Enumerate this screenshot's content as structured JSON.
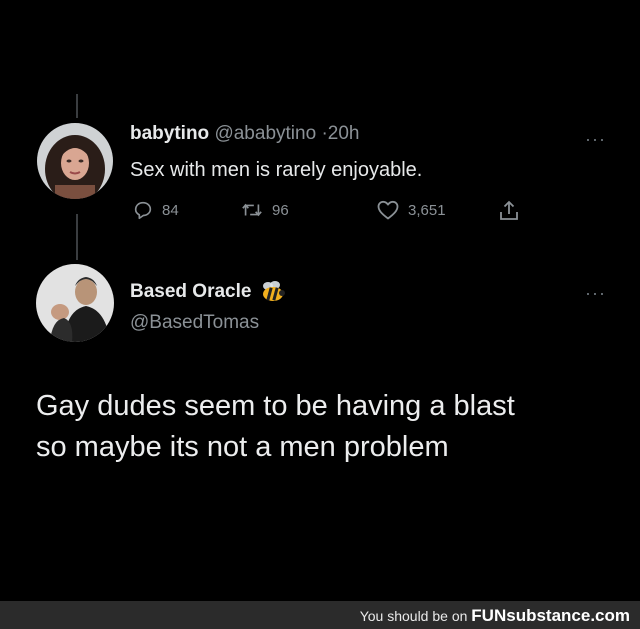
{
  "tweet1": {
    "name": "babytino",
    "handle": "@ababytino",
    "separator": "·",
    "time": "20h",
    "text": "Sex with men is rarely enjoyable.",
    "more": "···",
    "replies": "84",
    "retweets": "96",
    "likes": "3,651"
  },
  "tweet2": {
    "name": "Based Oracle",
    "name_emoji": "bee-icon",
    "handle": "@BasedTomas",
    "more": "···",
    "text_lines": [
      "Gay dudes seem to be having a blast",
      "so maybe its not a men problem"
    ]
  },
  "footer": {
    "prefix": "You should be on",
    "brand": "FUNsubstance.com"
  },
  "colors": {
    "background": "#000000",
    "text": "#e7e9ea",
    "muted": "#8b9196",
    "footer_bg": "#2b2b2b"
  }
}
